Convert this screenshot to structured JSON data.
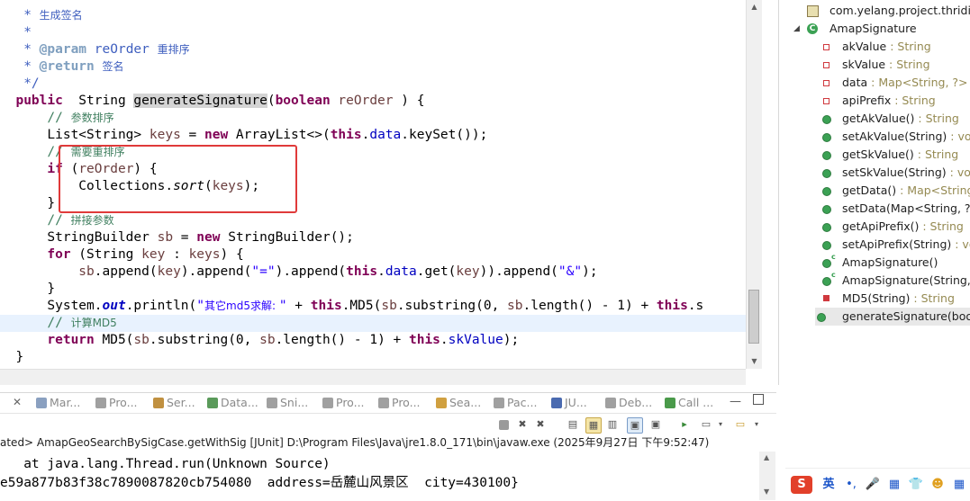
{
  "editor": {
    "lines": [
      [
        [
          "t-dc",
          "   * "
        ],
        [
          "t-dc cjk",
          "生成签名"
        ]
      ],
      [
        [
          "t-dc",
          "   *"
        ]
      ],
      [
        [
          "t-dc",
          "   * "
        ],
        [
          "t-tag",
          "@param"
        ],
        [
          "t-dc",
          " reOrder "
        ],
        [
          "t-dc cjk",
          "重排序"
        ]
      ],
      [
        [
          "t-dc",
          "   * "
        ],
        [
          "t-tag",
          "@return"
        ],
        [
          "t-dc",
          " "
        ],
        [
          "t-dc cjk",
          "签名"
        ]
      ],
      [
        [
          "t-dc",
          "   */"
        ]
      ],
      [
        [
          "t-kw",
          "  public"
        ],
        [
          "",
          "  String "
        ],
        [
          "t-hl",
          "generateSignature"
        ],
        [
          "",
          "("
        ],
        [
          "t-kw",
          "boolean"
        ],
        [
          "t-var",
          " reOrder"
        ],
        [
          "",
          " ) {"
        ]
      ],
      [
        [
          "t-cm",
          "      // "
        ],
        [
          "t-cm cjk",
          "参数排序"
        ]
      ],
      [
        [
          "",
          "      List<String> "
        ],
        [
          "t-var",
          "keys"
        ],
        [
          "",
          " = "
        ],
        [
          "t-kw",
          "new"
        ],
        [
          "",
          " ArrayList<>("
        ],
        [
          "t-kw",
          "this"
        ],
        [
          "",
          "."
        ],
        [
          "t-fld",
          "data"
        ],
        [
          "",
          ".keySet());"
        ]
      ],
      [
        [
          "t-cm",
          "      // "
        ],
        [
          "t-cm cjk",
          "需要重排序"
        ]
      ],
      [
        [
          "t-kw",
          "      if"
        ],
        [
          "",
          " ("
        ],
        [
          "t-var",
          "reOrder"
        ],
        [
          "",
          ") {"
        ]
      ],
      [
        [
          "",
          "          Collections."
        ],
        [
          "t-it",
          "sort"
        ],
        [
          "",
          "("
        ],
        [
          "t-var",
          "keys"
        ],
        [
          "",
          ");"
        ]
      ],
      [
        [
          "",
          "      }"
        ]
      ],
      [
        [
          "t-cm",
          "      // "
        ],
        [
          "t-cm cjk",
          "拼接参数"
        ]
      ],
      [
        [
          "",
          "      StringBuilder "
        ],
        [
          "t-var",
          "sb"
        ],
        [
          "",
          " = "
        ],
        [
          "t-kw",
          "new"
        ],
        [
          "",
          " StringBuilder();"
        ]
      ],
      [
        [
          "t-kw",
          "      for"
        ],
        [
          "",
          " (String "
        ],
        [
          "t-var",
          "key"
        ],
        [
          "",
          " : "
        ],
        [
          "t-var",
          "keys"
        ],
        [
          "",
          ") {"
        ]
      ],
      [
        [
          "t-var",
          "          sb"
        ],
        [
          "",
          ".append("
        ],
        [
          "t-var",
          "key"
        ],
        [
          "",
          ").append("
        ],
        [
          "t-str",
          "\"=\""
        ],
        [
          "",
          ").append("
        ],
        [
          "t-kw",
          "this"
        ],
        [
          "",
          "."
        ],
        [
          "t-fld",
          "data"
        ],
        [
          "",
          ".get("
        ],
        [
          "t-var",
          "key"
        ],
        [
          "",
          ")).append("
        ],
        [
          "t-str",
          "\"&\""
        ],
        [
          "",
          ");"
        ]
      ],
      [
        [
          "",
          "      }"
        ]
      ],
      [
        [
          "",
          "      System."
        ],
        [
          "t-sf",
          "out"
        ],
        [
          "",
          ".println("
        ],
        [
          "t-str",
          "\""
        ],
        [
          "t-str cjk",
          "其它md5求解: "
        ],
        [
          "t-str",
          "\""
        ],
        [
          "",
          " + "
        ],
        [
          "t-kw",
          "this"
        ],
        [
          "",
          ".MD5("
        ],
        [
          "t-var",
          "sb"
        ],
        [
          "",
          ".substring(0, "
        ],
        [
          "t-var",
          "sb"
        ],
        [
          "",
          ".length() - 1) + "
        ],
        [
          "t-kw",
          "this"
        ],
        [
          "",
          ".s"
        ]
      ],
      [
        [
          "t-cm",
          "      // "
        ],
        [
          "t-cm cjk",
          "计算MD5"
        ]
      ],
      [
        [
          "t-kw",
          "      return"
        ],
        [
          "",
          " MD5("
        ],
        [
          "t-var",
          "sb"
        ],
        [
          "",
          ".substring(0, "
        ],
        [
          "t-var",
          "sb"
        ],
        [
          "",
          ".length() - 1) + "
        ],
        [
          "t-kw",
          "this"
        ],
        [
          "",
          "."
        ],
        [
          "t-fld",
          "skValue"
        ],
        [
          "",
          ");"
        ]
      ],
      [
        [
          "",
          "  }"
        ]
      ]
    ]
  },
  "outline": {
    "package": "com.yelang.project.thridint",
    "class_name": "AmapSignature",
    "members": [
      {
        "icon": "private-field-icon",
        "label": "akValue",
        "type": " : String"
      },
      {
        "icon": "private-field-icon",
        "label": "skValue",
        "type": " : String"
      },
      {
        "icon": "private-field-icon",
        "label": "data",
        "type": " : Map<String, ?>"
      },
      {
        "icon": "private-field-icon",
        "label": "apiPrefix",
        "type": " : String"
      },
      {
        "icon": "public-method-icon",
        "label": "getAkValue()",
        "type": " : String"
      },
      {
        "icon": "public-method-icon",
        "label": "setAkValue(String)",
        "type": " : void"
      },
      {
        "icon": "public-method-icon",
        "label": "getSkValue()",
        "type": " : String"
      },
      {
        "icon": "public-method-icon",
        "label": "setSkValue(String)",
        "type": " : void"
      },
      {
        "icon": "public-method-icon",
        "label": "getData()",
        "type": " : Map<String, ?>"
      },
      {
        "icon": "public-method-icon",
        "label": "setData(Map<String, ?>)",
        "type": ""
      },
      {
        "icon": "public-method-icon",
        "label": "getApiPrefix()",
        "type": " : String"
      },
      {
        "icon": "public-method-icon",
        "label": "setApiPrefix(String)",
        "type": " : void"
      },
      {
        "icon": "constructor-icon",
        "label": "AmapSignature()",
        "type": ""
      },
      {
        "icon": "constructor-icon",
        "label": "AmapSignature(String, String)",
        "type": ""
      },
      {
        "icon": "private-method-icon",
        "label": "MD5(String)",
        "type": " : String"
      },
      {
        "icon": "public-method-icon",
        "label": "generateSignature(boolean)",
        "type": ""
      }
    ]
  },
  "bottom_tabs": [
    "Mar...",
    "Pro...",
    "Ser...",
    "Data...",
    "Sni...",
    "Pro...",
    "Pro...",
    "Sea...",
    "Pac...",
    "JU...",
    "Deb...",
    "Call ..."
  ],
  "console": {
    "header": "ated> AmapGeoSearchBySigCase.getWithSig [JUnit] D:\\Program Files\\Java\\jre1.8.0_171\\bin\\javaw.exe (2025年9月27日 下午9:52:47)",
    "lines": [
      "   at java.lang.Thread.run(Unknown Source)",
      "e59a877b83f38c7890087820cb754080  address=岳麓山风景区  city=430100}"
    ]
  },
  "ime": {
    "logo": "S",
    "lang": "英"
  }
}
